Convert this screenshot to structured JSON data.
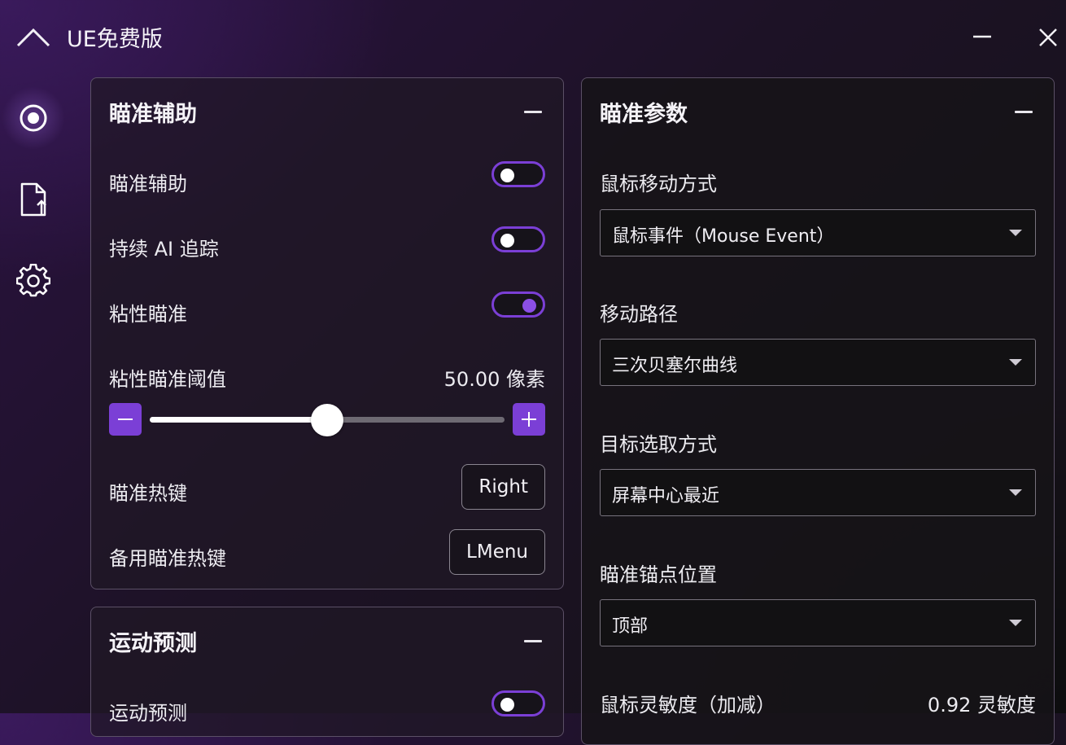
{
  "window": {
    "title": "UE免费版"
  },
  "aim_assist": {
    "title": "瞄准辅助",
    "aim_assist_label": "瞄准辅助",
    "ai_tracking_label": "持续 AI 追踪",
    "sticky_aim_label": "粘性瞄准",
    "sticky_threshold_label": "粘性瞄准阈值",
    "sticky_threshold_value": "50.00 像素",
    "sticky_threshold_fraction": 0.5,
    "hotkey_label": "瞄准热键",
    "hotkey_value": "Right",
    "alt_hotkey_label": "备用瞄准热键",
    "alt_hotkey_value": "LMenu",
    "toggles": {
      "aim_assist": false,
      "ai_tracking": false,
      "sticky_aim": true
    }
  },
  "motion_prediction": {
    "title": "运动预测",
    "enable_label": "运动预测",
    "enabled": false
  },
  "aim_params": {
    "title": "瞄准参数",
    "mouse_method_label": "鼠标移动方式",
    "mouse_method_value": "鼠标事件（Mouse Event）",
    "path_label": "移动路径",
    "path_value": "三次贝塞尔曲线",
    "target_label": "目标选取方式",
    "target_value": "屏幕中心最近",
    "anchor_label": "瞄准锚点位置",
    "anchor_value": "顶部",
    "sensitivity_label": "鼠标灵敏度（加减）",
    "sensitivity_value": "0.92 灵敏度"
  },
  "colors": {
    "accent": "#7b3fd6",
    "accent_knob": "#8b4fe6",
    "card_border": "#5b5066"
  },
  "icons": [
    "chevron-up-icon",
    "minimize-icon",
    "close-icon",
    "target-icon",
    "export-icon",
    "gear-icon",
    "minus-icon",
    "plus-icon",
    "dropdown-caret-icon"
  ]
}
